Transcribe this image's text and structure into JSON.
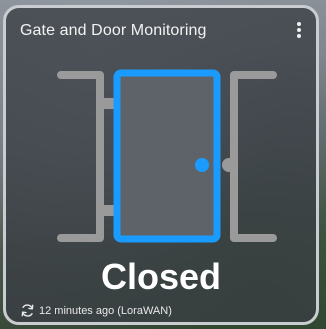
{
  "card": {
    "title": "Gate and Door Monitoring",
    "status": "Closed",
    "last_update": "12 minutes ago (LoraWAN)"
  },
  "icons": {
    "menu": "more-vertical-icon",
    "door": "door-closed-icon",
    "refresh": "refresh-icon"
  },
  "colors": {
    "door_accent": "#1a9bff",
    "frame_gray": "#9a9a9a",
    "card_border": "#c9cdd1"
  }
}
